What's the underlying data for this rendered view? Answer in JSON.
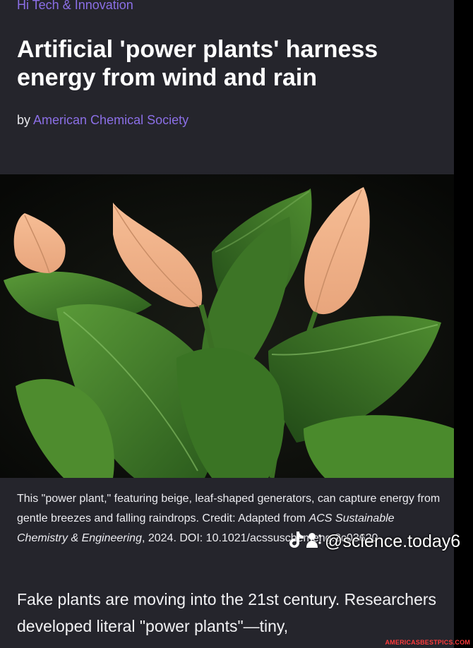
{
  "article": {
    "category": "Hi Tech & Innovation",
    "headline": "Artificial 'power plants' harness energy from wind and rain",
    "byline_prefix": "by",
    "author": "American Chemical Society",
    "caption": {
      "text_before": "This \"power plant,\" featuring beige, leaf-shaped generators, can capture energy from gentle breezes and falling raindrops. Credit: Adapted from ",
      "journal": "ACS Sustainable Chemistry & Engineering",
      "text_after": ", 2024. DOI: 10.1021/acssuschemeng.3c03620"
    },
    "body": "Fake plants are moving into the 21st century. Researchers developed literal \"power plants\"—tiny,"
  },
  "photo": {
    "subject": "potted plant with green leaves and beige leaf-shaped generators",
    "background_color": "#0b0d0a",
    "leaf_color": "#3f7d2a",
    "generator_color": "#f0b088"
  },
  "overlay": {
    "watermark_icon": "tiktok-icon",
    "watermark_text": "@science.today6",
    "site_badge": "AMERICASBESTPICS.COM"
  },
  "colors": {
    "page_background": "#25252c",
    "link": "#8b6fe6",
    "outer_background": "#000000",
    "badge": "#ff3b3b"
  }
}
